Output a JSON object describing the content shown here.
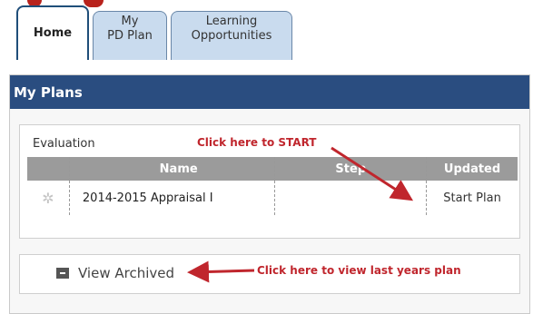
{
  "tabs": [
    {
      "lines": [
        "Home"
      ],
      "active": true
    },
    {
      "lines": [
        "My",
        "PD Plan"
      ],
      "active": false
    },
    {
      "lines": [
        "Learning",
        "Opportunities"
      ],
      "active": false
    }
  ],
  "panel": {
    "title": "My Plans",
    "section_label": "Evaluation",
    "table": {
      "headers": {
        "name": "Name",
        "step": "Step",
        "updated": "Updated"
      },
      "rows": [
        {
          "icon": "gear-icon",
          "name": "2014-2015 Appraisal I",
          "step": "",
          "updated": "Start Plan"
        }
      ]
    },
    "archived_label": "View Archived"
  },
  "annotations": {
    "start": "Click here to START",
    "archived": "Click here to view last years plan",
    "color": "#c0262d"
  },
  "colors": {
    "header_bg": "#2a4d80",
    "tab_inactive_bg": "#c9dbee",
    "table_header_bg": "#9b9b9b"
  }
}
